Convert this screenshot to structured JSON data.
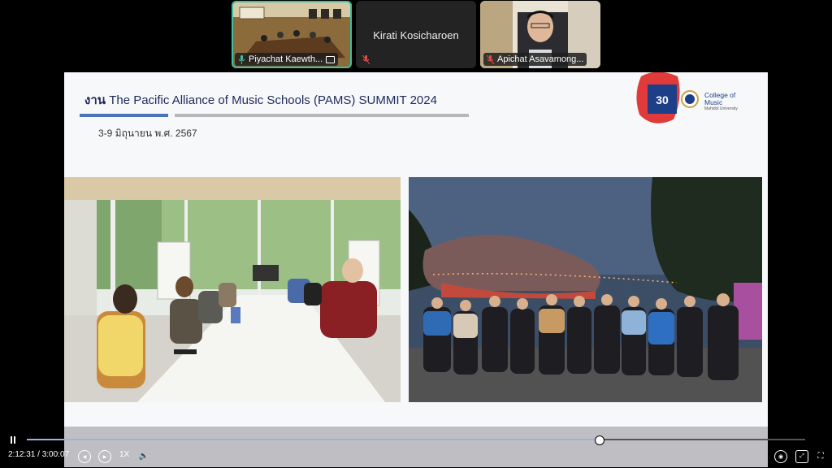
{
  "participants": [
    {
      "name": "Piyachat Kaewth...",
      "status": "speaking"
    },
    {
      "name": "Kirati Kosicharoen",
      "status": "muted"
    },
    {
      "name": "Apichat Asavamong...",
      "status": "muted"
    }
  ],
  "slide": {
    "title_thai": "งาน",
    "title_main": "The Pacific Alliance of Music Schools (PAMS) SUMMIT 2024",
    "subtitle": "3-9 มิถุนายน พ.ศ. 2567",
    "logo_number": "30",
    "logo_name": "College of Music",
    "logo_sub": "Mahidol University"
  },
  "player": {
    "current_time": "2:12:31",
    "separator": "/",
    "duration": "3:00:07",
    "speed": "1X",
    "progress": 0.7348
  },
  "colors": {
    "accent": "#3fbfa3",
    "brand_blue": "#1d3f88",
    "logo_red": "#e03a3a"
  }
}
